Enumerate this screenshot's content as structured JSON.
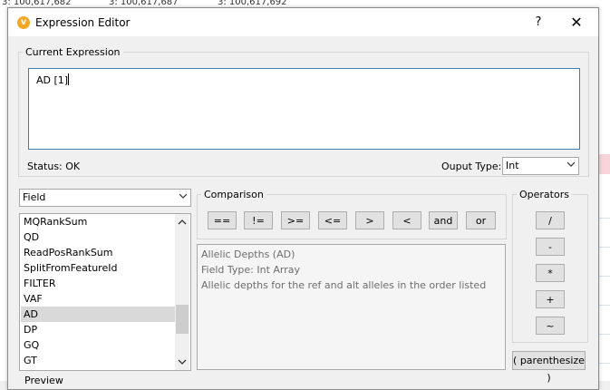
{
  "background": {
    "row_values": [
      "3: 100,617,682",
      "3: 100,617,687",
      "3: 100,617,692"
    ]
  },
  "dialog": {
    "title": "Expression Editor",
    "help_label": "?",
    "close_label": "✕",
    "current_expression": {
      "legend": "Current Expression",
      "value": "AD [1]"
    },
    "status_text": "Status: OK",
    "output_type": {
      "label": "Ouput Type:",
      "value": "Int"
    },
    "field_selector": {
      "value": "Field"
    },
    "fields": [
      "MQRankSum",
      "QD",
      "ReadPosRankSum",
      "SplitFromFeatureId",
      "FILTER",
      "VAF",
      "AD",
      "DP",
      "GQ",
      "GT"
    ],
    "selected_field": "AD",
    "comparison": {
      "legend": "Comparison",
      "buttons": [
        "==",
        "!=",
        ">=",
        "<=",
        ">",
        "<",
        "and",
        "or"
      ]
    },
    "operators": {
      "legend": "Operators",
      "buttons": [
        "/",
        "-",
        "*",
        "+",
        "~"
      ]
    },
    "description": {
      "line1": "Allelic Depths (AD)",
      "line2": "Field Type: Int Array",
      "line3": "Allelic depths for the ref and alt alleles in the order listed"
    },
    "parenthesize_label": "( parenthesize )",
    "preview_label": "Preview"
  }
}
